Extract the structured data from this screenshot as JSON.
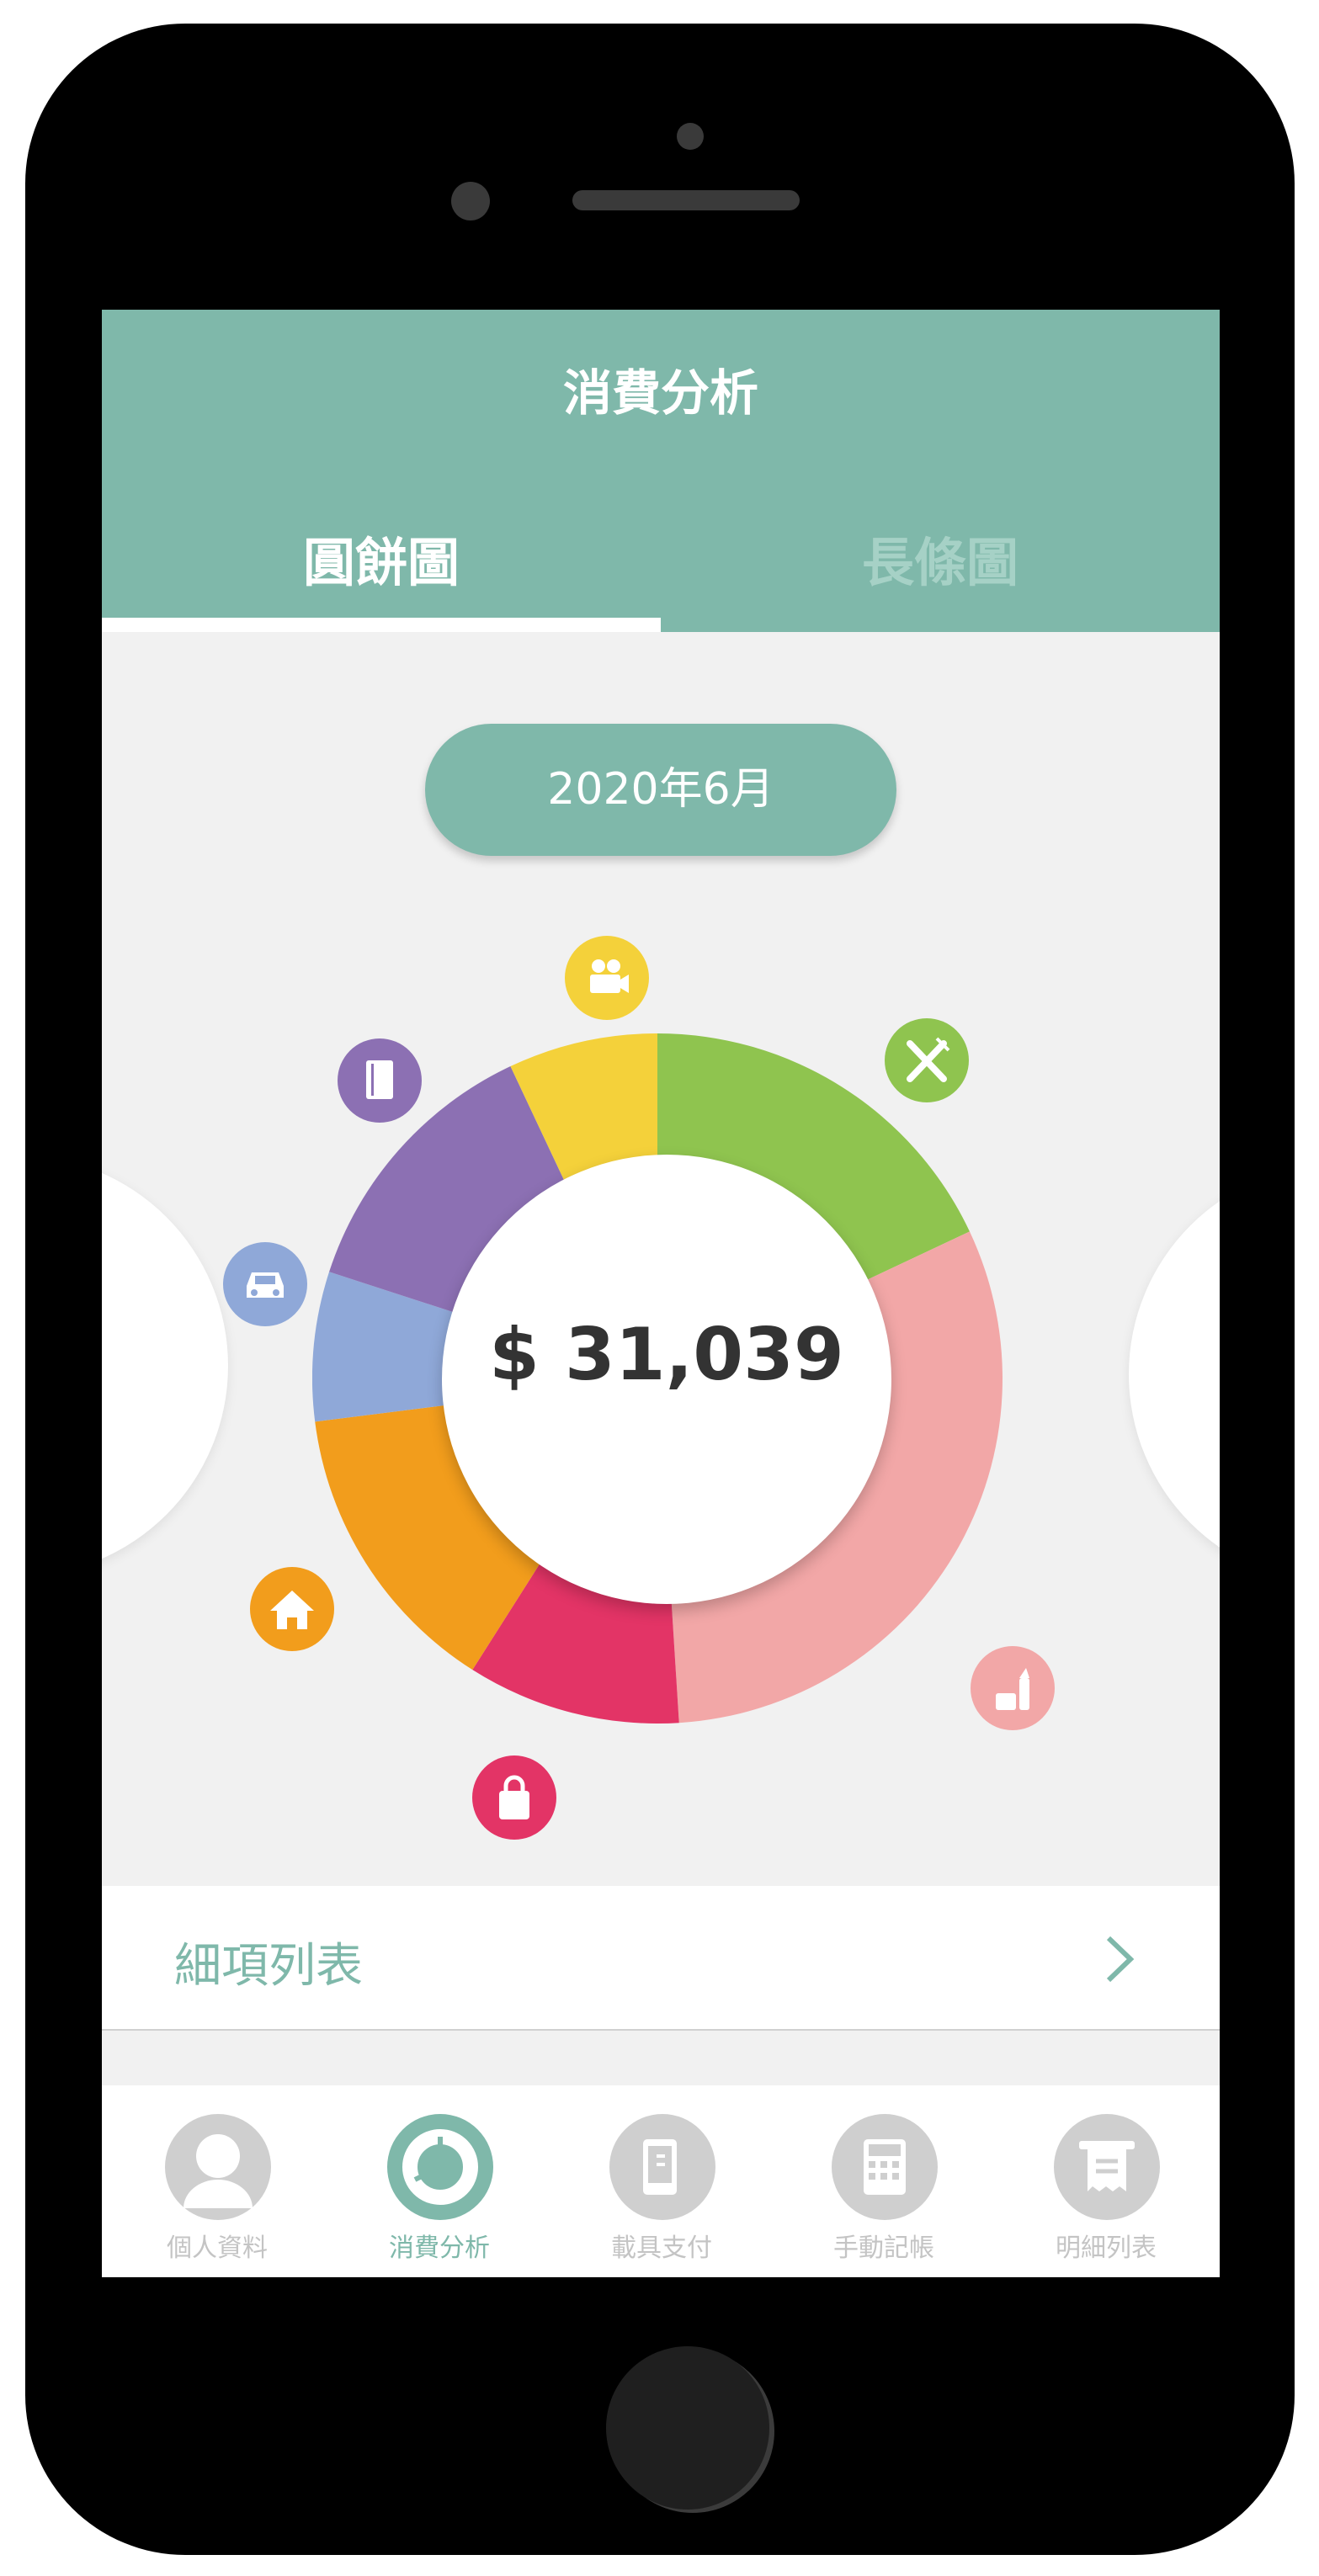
{
  "header": {
    "title": "消費分析"
  },
  "tabs": [
    {
      "label": "圓餅圖",
      "active": true
    },
    {
      "label": "長條圖",
      "active": false
    }
  ],
  "month": "2020年6月",
  "total": "$ 31,039",
  "chart_data": {
    "type": "pie",
    "values": [
      18,
      31,
      10,
      14,
      7,
      13,
      7
    ],
    "colors": [
      "#8fc44f",
      "#f2a7a7",
      "#e33466",
      "#f29d1c",
      "#8fa8d8",
      "#8c70b3",
      "#f4d13a"
    ],
    "icons": [
      "food-icon",
      "cosmetics-icon",
      "shopping-bag-icon",
      "home-icon",
      "car-icon",
      "book-icon",
      "movie-camera-icon"
    ]
  },
  "detail": {
    "label": "細項列表"
  },
  "nav": [
    {
      "label": "個人資料",
      "icon": "user-icon",
      "active": false
    },
    {
      "label": "消費分析",
      "icon": "pie-chart-icon",
      "active": true
    },
    {
      "label": "載具支付",
      "icon": "mobile-pay-icon",
      "active": false
    },
    {
      "label": "手動記帳",
      "icon": "calculator-icon",
      "active": false
    },
    {
      "label": "明細列表",
      "icon": "receipt-icon",
      "active": false
    }
  ]
}
